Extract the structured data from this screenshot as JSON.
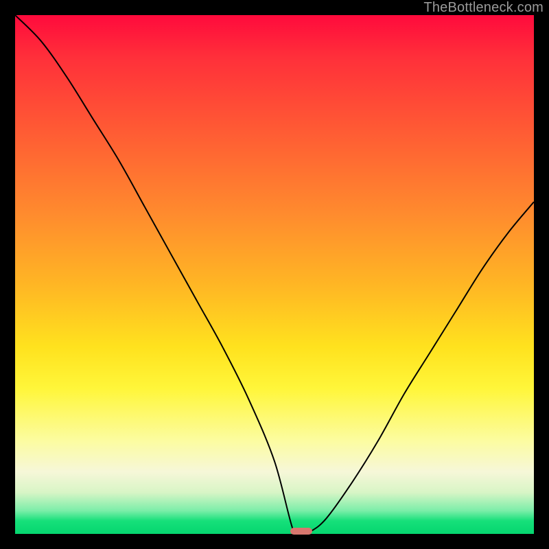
{
  "watermark": "TheBottleneck.com",
  "colors": {
    "frame_bg": "#000000",
    "curve": "#000000",
    "marker": "#d8766e",
    "gradient_top": "#ff0a3c",
    "gradient_bottom": "#05d66f"
  },
  "chart_data": {
    "type": "line",
    "title": "",
    "xlabel": "",
    "ylabel": "",
    "xlim": [
      0,
      100
    ],
    "ylim": [
      0,
      100
    ],
    "grid": false,
    "x": [
      0,
      5,
      10,
      15,
      20,
      25,
      30,
      35,
      40,
      45,
      50,
      53.5,
      55,
      57,
      60,
      65,
      70,
      75,
      80,
      85,
      90,
      95,
      100
    ],
    "values": [
      100,
      95,
      88,
      80,
      72,
      63,
      54,
      45,
      36,
      26,
      14,
      1,
      0,
      0.5,
      3,
      10,
      18,
      27,
      35,
      43,
      51,
      58,
      64
    ],
    "marker": {
      "x": 55.2,
      "y": 0,
      "width_x": 4.2,
      "height_y": 1.3
    },
    "legend": null,
    "annotations": []
  }
}
